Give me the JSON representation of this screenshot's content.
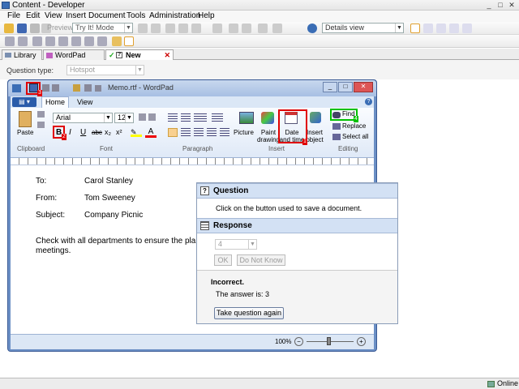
{
  "app": {
    "title": "Content - Developer"
  },
  "menu": [
    "File",
    "Edit",
    "View",
    "Insert",
    "Document",
    "Tools",
    "Administration",
    "Help"
  ],
  "toolbar": {
    "preview_label": "Preview",
    "mode_combo": "Try It! Mode",
    "view_combo": "Details view"
  },
  "tabs": [
    {
      "label": "Library"
    },
    {
      "label": "WordPad Training"
    },
    {
      "label": "New Question"
    }
  ],
  "question_type": {
    "label": "Question type:",
    "value": "Hotspot"
  },
  "wordpad": {
    "title": "Memo.rtf - WordPad",
    "ribbon_tabs": [
      "Home",
      "View"
    ],
    "font_name": "Arial",
    "font_size": "12",
    "buttons": {
      "paste": "Paste",
      "picture": "Picture",
      "paint": "Paint drawing",
      "date_time": "Date and time",
      "insert_object": "Insert object",
      "find": "Find",
      "replace": "Replace",
      "select_all": "Select all"
    },
    "groups": [
      "Clipboard",
      "Font",
      "Paragraph",
      "Insert",
      "Editing"
    ],
    "markers": {
      "save": "3",
      "bold": "2",
      "date": "1",
      "find": "4"
    },
    "doc": {
      "to_label": "To:",
      "to_value": "Carol Stanley",
      "from_label": "From:",
      "from_value": "Tom Sweeney",
      "subject_label": "Subject:",
      "subject_value": "Company Picnic",
      "body_line1": "Check with all departments to ensure the plann",
      "body_line2": "meetings."
    },
    "zoom": "100%"
  },
  "dialog": {
    "question_header": "Question",
    "question_text": "Click on the button used to save a document.",
    "response_header": "Response",
    "response_value": "4",
    "ok": "OK",
    "do_not_know": "Do Not Know",
    "result_title": "Incorrect.",
    "result_text": "The answer is: 3",
    "retry": "Take question again"
  },
  "status": {
    "online": "Online"
  },
  "colors": {
    "highlight_red": "#e00000",
    "highlight_green": "#00c000",
    "wordpad_frame": "#6b8fc5"
  }
}
